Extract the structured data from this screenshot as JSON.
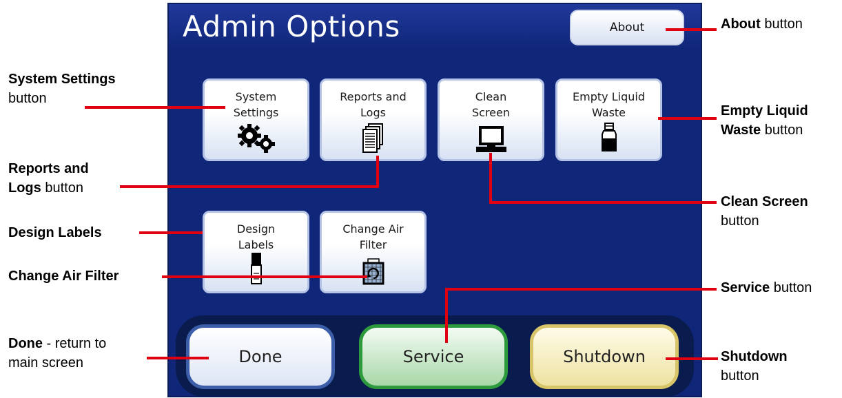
{
  "screen": {
    "title": "Admin Options",
    "about_label": "About",
    "tiles": [
      {
        "label": "System\nSettings",
        "icon": "gears-icon"
      },
      {
        "label": "Reports and\nLogs",
        "icon": "documents-icon"
      },
      {
        "label": "Clean\nScreen",
        "icon": "monitor-icon"
      },
      {
        "label": "Empty Liquid\nWaste",
        "icon": "bottle-icon"
      },
      {
        "label": "Design\nLabels",
        "icon": "label-roll-icon"
      },
      {
        "label": "Change Air\nFilter",
        "icon": "air-filter-icon"
      }
    ],
    "bottom": {
      "done_label": "Done",
      "service_label": "Service",
      "shutdown_label": "Shutdown"
    }
  },
  "callouts": {
    "about": {
      "bold": "About",
      "rest": " button"
    },
    "system_settings": {
      "bold": "System Settings",
      "rest": "button"
    },
    "reports": {
      "bold": "Reports and\nLogs",
      "rest": " button"
    },
    "design_labels": {
      "bold": "Design Labels",
      "rest": ""
    },
    "change_air_filter": {
      "bold": "Change Air Filter",
      "rest": ""
    },
    "done": {
      "bold": "Done",
      "rest": " - return to\nmain screen"
    },
    "empty_liquid": {
      "bold": "Empty Liquid\nWaste",
      "rest": " button"
    },
    "clean_screen": {
      "bold": "Clean Screen",
      "rest": "button"
    },
    "service": {
      "bold": "Service",
      "rest": " button"
    },
    "shutdown": {
      "bold": "Shutdown",
      "rest": "button"
    }
  },
  "colors": {
    "screen_bg": "#0f2679",
    "callout_line": "#e00012",
    "done_border": "#3c5ea8",
    "service_border": "#2e9a3e",
    "shutdown_border": "#d9c569"
  }
}
